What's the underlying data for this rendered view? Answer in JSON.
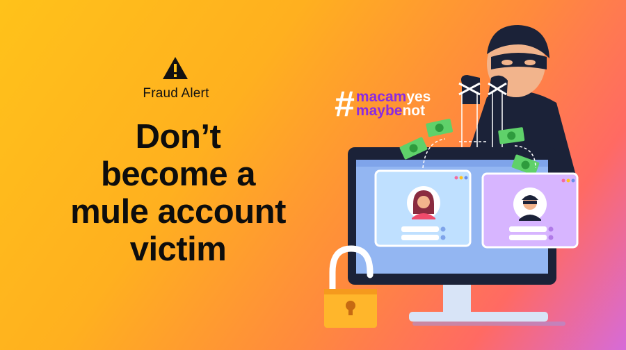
{
  "alert": {
    "icon": "warning-icon",
    "label": "Fraud Alert"
  },
  "headline": {
    "line1": "Don’t",
    "line2": "become a",
    "line3": "mule account",
    "line4": "victim"
  },
  "hashtag": {
    "symbol": "#",
    "line1_a": "macam",
    "line1_b": "yes",
    "line2_a": "maybe",
    "line2_b": "not"
  },
  "colors": {
    "hashtag_purple": "#8a2be2",
    "headline": "#0d0d0d",
    "background_start": "#ffc21a",
    "background_end": "#d66bd8"
  }
}
